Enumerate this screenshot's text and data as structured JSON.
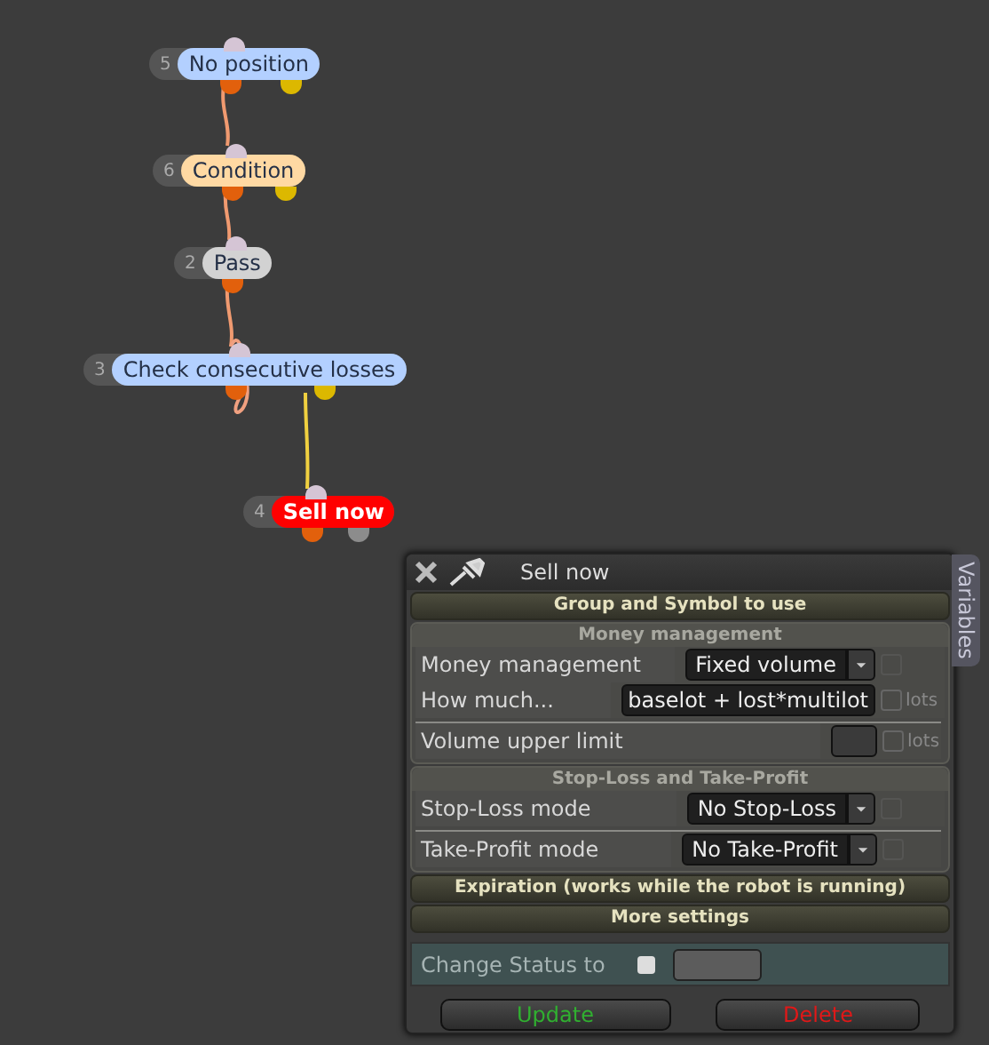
{
  "canvas": {
    "nodes": [
      {
        "number": "5",
        "label": "No position",
        "color": "#b3d0ff",
        "outputs": [
          {
            "color": "#e2600c"
          },
          {
            "color": "#dcb800"
          }
        ]
      },
      {
        "number": "6",
        "label": "Condition",
        "color": "#ffd9a3",
        "outputs": [
          {
            "color": "#e2600c"
          },
          {
            "color": "#dcb800"
          }
        ]
      },
      {
        "number": "2",
        "label": "Pass",
        "color": "#d2d2d2",
        "outputs": [
          {
            "color": "#e2600c"
          }
        ]
      },
      {
        "number": "3",
        "label": "Check consecutive losses",
        "color": "#b3d0ff",
        "outputs": [
          {
            "color": "#e2600c"
          },
          {
            "color": "#dcb800"
          }
        ]
      },
      {
        "number": "4",
        "label": "Sell now",
        "color": "#ff0000",
        "outputs": [
          {
            "color": "#e2600c"
          },
          {
            "color": "#8c8c8c"
          }
        ]
      }
    ]
  },
  "panel": {
    "title": "Sell now",
    "side_tab": "Variables",
    "sections": [
      {
        "kind": "header",
        "title": "Group and Symbol to use"
      },
      {
        "kind": "group",
        "title": "Money management",
        "rows": [
          {
            "kind": "select",
            "label": "Money management",
            "value": "Fixed volume",
            "checked": false,
            "divider_before": false
          },
          {
            "kind": "input",
            "label": "How much...",
            "value": "baselot + lost*multilot",
            "unit": "lots",
            "checked": false,
            "divider_before": false
          },
          {
            "kind": "number",
            "label": "Volume upper limit",
            "unit": "lots",
            "checked": false,
            "divider_before": true
          }
        ]
      },
      {
        "kind": "group",
        "title": "Stop-Loss and Take-Profit",
        "rows": [
          {
            "kind": "select",
            "label": "Stop-Loss mode",
            "value": "No Stop-Loss",
            "checked": false,
            "divider_before": false
          },
          {
            "kind": "select",
            "label": "Take-Profit mode",
            "value": "No Take-Profit",
            "checked": false,
            "divider_before": true
          }
        ]
      },
      {
        "kind": "header",
        "title": "Expiration (works while the robot is running)"
      },
      {
        "kind": "header",
        "title": "More settings"
      }
    ],
    "status": {
      "label": "Change Status to",
      "checked": false
    },
    "buttons": [
      {
        "label": "Update",
        "kind": "confirm"
      },
      {
        "label": "Delete",
        "kind": "danger"
      }
    ]
  }
}
